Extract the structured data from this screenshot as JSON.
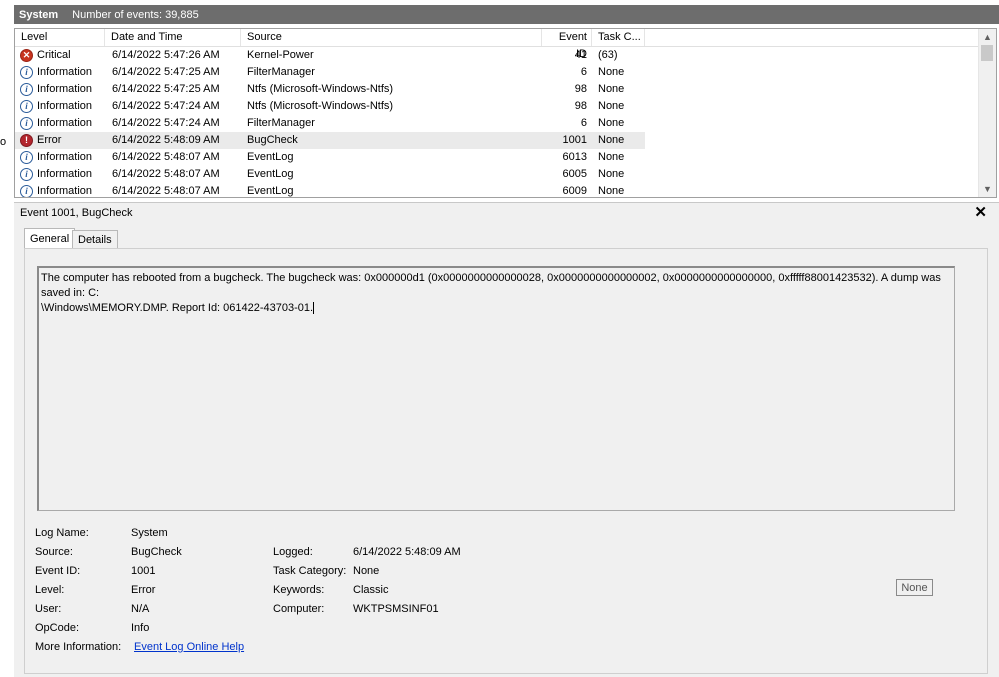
{
  "header": {
    "log_name": "System",
    "event_count": "Number of events: 39,885"
  },
  "left_edge_text": "o",
  "columns": {
    "level": "Level",
    "date_time": "Date and Time",
    "source": "Source",
    "event_id": "Event ID",
    "task_category": "Task C..."
  },
  "events": [
    {
      "level": "Critical",
      "icon": "critical-icon",
      "date": "6/14/2022 5:47:26 AM",
      "source": "Kernel-Power",
      "event_id": "41",
      "task": "(63)"
    },
    {
      "level": "Information",
      "icon": "information-icon",
      "date": "6/14/2022 5:47:25 AM",
      "source": "FilterManager",
      "event_id": "6",
      "task": "None"
    },
    {
      "level": "Information",
      "icon": "information-icon",
      "date": "6/14/2022 5:47:25 AM",
      "source": "Ntfs (Microsoft-Windows-Ntfs)",
      "event_id": "98",
      "task": "None"
    },
    {
      "level": "Information",
      "icon": "information-icon",
      "date": "6/14/2022 5:47:24 AM",
      "source": "Ntfs (Microsoft-Windows-Ntfs)",
      "event_id": "98",
      "task": "None"
    },
    {
      "level": "Information",
      "icon": "information-icon",
      "date": "6/14/2022 5:47:24 AM",
      "source": "FilterManager",
      "event_id": "6",
      "task": "None"
    },
    {
      "level": "Error",
      "icon": "error-icon",
      "date": "6/14/2022 5:48:09 AM",
      "source": "BugCheck",
      "event_id": "1001",
      "task": "None",
      "selected": true
    },
    {
      "level": "Information",
      "icon": "information-icon",
      "date": "6/14/2022 5:48:07 AM",
      "source": "EventLog",
      "event_id": "6013",
      "task": "None"
    },
    {
      "level": "Information",
      "icon": "information-icon",
      "date": "6/14/2022 5:48:07 AM",
      "source": "EventLog",
      "event_id": "6005",
      "task": "None"
    },
    {
      "level": "Information",
      "icon": "information-icon",
      "date": "6/14/2022 5:48:07 AM",
      "source": "EventLog",
      "event_id": "6009",
      "task": "None"
    }
  ],
  "detail": {
    "title": "Event 1001, BugCheck",
    "close": "✕",
    "tabs": [
      "General",
      "Details"
    ],
    "description_line1": "The computer has rebooted from a bugcheck.  The bugcheck was: 0x000000d1 (0x0000000000000028, 0x0000000000000002, 0x0000000000000000, 0xfffff88001423532). A dump was saved in: C:",
    "description_line2": "\\Windows\\MEMORY.DMP. Report Id: 061422-43703-01.",
    "labels": {
      "log_name": "Log Name:",
      "source": "Source:",
      "event_id": "Event ID:",
      "level": "Level:",
      "user": "User:",
      "opcode": "OpCode:",
      "more_info": "More Information:",
      "logged": "Logged:",
      "task_category": "Task Category:",
      "keywords": "Keywords:",
      "computer": "Computer:"
    },
    "values": {
      "log_name": "System",
      "source": "BugCheck",
      "event_id": "1001",
      "level": "Error",
      "user": "N/A",
      "opcode": "Info",
      "more_info_link": "Event Log Online Help",
      "logged": "6/14/2022 5:48:09 AM",
      "task_category": "None",
      "keywords": "Classic",
      "computer": "WKTPSMSINF01"
    },
    "none_button": "None"
  }
}
